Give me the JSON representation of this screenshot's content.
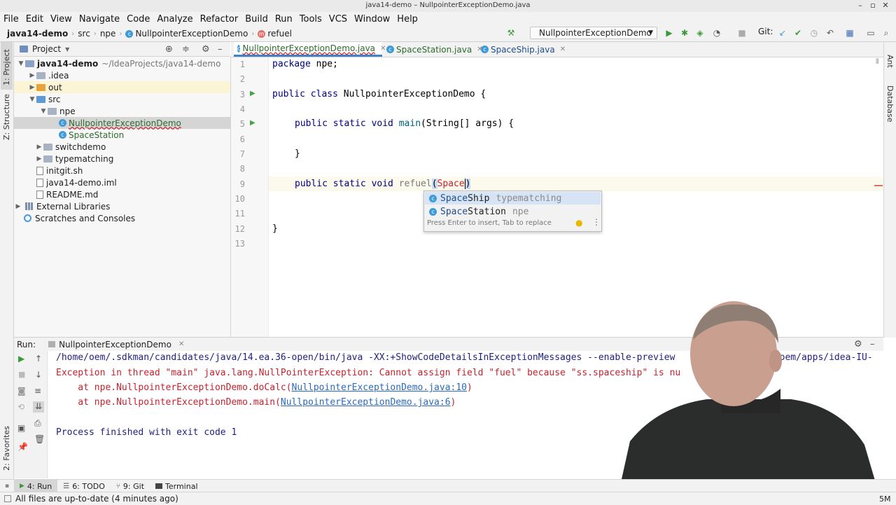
{
  "window": {
    "title": "java14-demo – NullpointerExceptionDemo.java"
  },
  "menu": [
    "File",
    "Edit",
    "View",
    "Navigate",
    "Code",
    "Analyze",
    "Refactor",
    "Build",
    "Run",
    "Tools",
    "VCS",
    "Window",
    "Help"
  ],
  "breadcrumb": {
    "project": "java14-demo",
    "src": "src",
    "pkg": "npe",
    "cls": "NullpointerExceptionDemo",
    "method": "refuel"
  },
  "toolbar": {
    "run_config": "NullpointerExceptionDemo",
    "git_label": "Git:"
  },
  "left_stripe": {
    "project": "1: Project",
    "structure": "Z: Structure",
    "favorites": "2: Favorites"
  },
  "right_stripe": {
    "ant": "Ant",
    "database": "Database"
  },
  "project_panel": {
    "title": "Project",
    "tree": [
      {
        "label": "java14-demo",
        "suffix": "~/IdeaProjects/java14-demo"
      },
      {
        "label": ".idea"
      },
      {
        "label": "out"
      },
      {
        "label": "src"
      },
      {
        "label": "npe"
      },
      {
        "label": "NullpointerExceptionDemo"
      },
      {
        "label": "SpaceStation"
      },
      {
        "label": "switchdemo"
      },
      {
        "label": "typematching"
      },
      {
        "label": "initgit.sh"
      },
      {
        "label": "java14-demo.iml"
      },
      {
        "label": "README.md"
      },
      {
        "label": "External Libraries"
      },
      {
        "label": "Scratches and Consoles"
      }
    ]
  },
  "tabs": [
    {
      "label": "NullpointerExceptionDemo.java",
      "active": true
    },
    {
      "label": "SpaceStation.java"
    },
    {
      "label": "SpaceShip.java"
    }
  ],
  "editor": {
    "lines": [
      "1",
      "2",
      "3",
      "4",
      "5",
      "6",
      "7",
      "8",
      "9",
      "10",
      "11",
      "12",
      "13"
    ],
    "code": {
      "l1_kw": "package",
      "l1_rest": " npe;",
      "l3_kw": "public class",
      "l3_rest": " NullpointerExceptionDemo {",
      "l5_kw": "public static void",
      "l5_fn": " main",
      "l5_rest": "(String[] args) {",
      "l7": "}",
      "l9_kw": "public static void",
      "l9_fn": " refuel",
      "l9_open": "(",
      "l9_typed": "Space",
      "l9_close": ")",
      "l12": "}"
    }
  },
  "completion": {
    "items": [
      {
        "match": "Space",
        "rest": "Ship",
        "pkg": "typematching"
      },
      {
        "match": "Space",
        "rest": "Station",
        "pkg": "npe"
      }
    ],
    "hint": "Press Enter to insert, Tab to replace"
  },
  "run_panel": {
    "label": "Run:",
    "tab": "NullpointerExceptionDemo",
    "console": {
      "cmd": "/home/oem/.sdkman/candidates/java/14.ea.36-open/bin/java -XX:+ShowCodeDetailsInExceptionMessages --enable-preview",
      "cmd_tail": "e/oem/apps/idea-IU-",
      "exc": "Exception in thread \"main\" java.lang.NullPointerException: Cannot assign field \"fuel\" because \"ss.spaceship\" is nu",
      "at1_pre": "    at npe.NullpointerExceptionDemo.doCalc(",
      "at1_link": "NullpointerExceptionDemo.java:10",
      "at1_post": ")",
      "at2_pre": "    at npe.NullpointerExceptionDemo.main(",
      "at2_link": "NullpointerExceptionDemo.java:6",
      "at2_post": ")",
      "exit": "Process finished with exit code 1"
    }
  },
  "bottom_tools": [
    {
      "label": "4: Run"
    },
    {
      "label": "6: TODO"
    },
    {
      "label": "9: Git"
    },
    {
      "label": "Terminal"
    }
  ],
  "status": {
    "text": "All files are up-to-date (4 minutes ago)",
    "mem": "5M"
  },
  "colors": {
    "accent": "#3e9bd8",
    "selection": "#d4d4d4",
    "link": "#2a6abf",
    "error": "#c7222d",
    "string": "#067d17",
    "keyword": "#000080"
  }
}
